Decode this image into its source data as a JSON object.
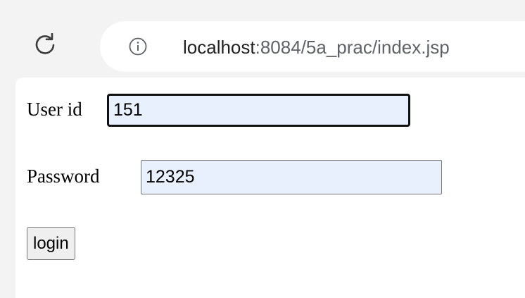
{
  "browser": {
    "reload_icon": "reload-icon",
    "info_icon": "info-icon",
    "url_host": "localhost",
    "url_path": ":8084/5a_prac/index.jsp"
  },
  "form": {
    "userid_label": "User id",
    "userid_value": "151",
    "password_label": "Password",
    "password_value": "12325",
    "login_label": "login"
  },
  "colors": {
    "autofill_bg": "#e8f0fe",
    "chrome_bg": "#f3f3f3"
  }
}
